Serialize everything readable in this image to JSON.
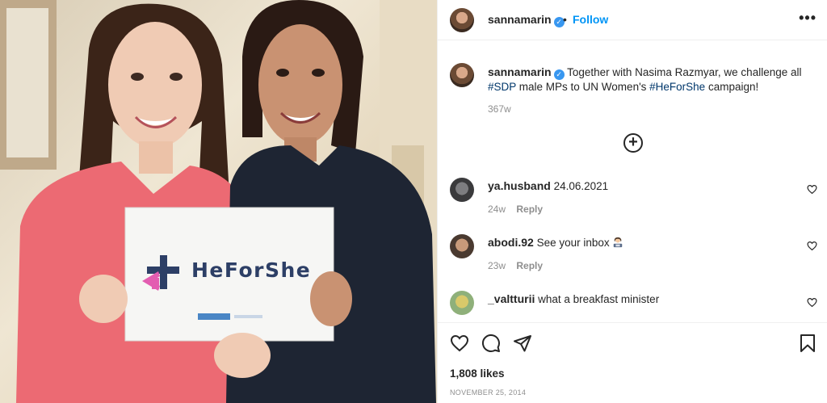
{
  "post": {
    "author": "sannamarin",
    "verified_badge": "✓",
    "dot": "•",
    "follow_label": "Follow",
    "more_label": "•••",
    "photo_sign_text": "HeForShe"
  },
  "caption": {
    "username": "sannamarin",
    "text_1": "Together with Nasima Razmyar, we challenge all",
    "hashtag_sdp": "#SDP",
    "text_2": " male MPs to UN Women's ",
    "hashtag_heforshe": "#HeForShe",
    "text_3": " campaign!",
    "time": "367w"
  },
  "load_more_label": "+",
  "comments": [
    {
      "username": "ya.husband",
      "text": "24.06.2021",
      "time": "24w",
      "reply_label": "Reply"
    },
    {
      "username": "abodi.92",
      "text": "See your inbox",
      "time": "23w",
      "reply_label": "Reply"
    },
    {
      "username": "_valtturii",
      "text": "what a breakfast minister"
    }
  ],
  "actions": {
    "icons": [
      "heart-icon",
      "comment-icon",
      "share-icon",
      "bookmark-icon"
    ],
    "likes": "1,808 likes",
    "date": "NOVEMBER 25, 2014"
  },
  "colors": {
    "accent": "#0095f6",
    "hashtag": "#00376b",
    "muted": "#8e8e8e"
  }
}
